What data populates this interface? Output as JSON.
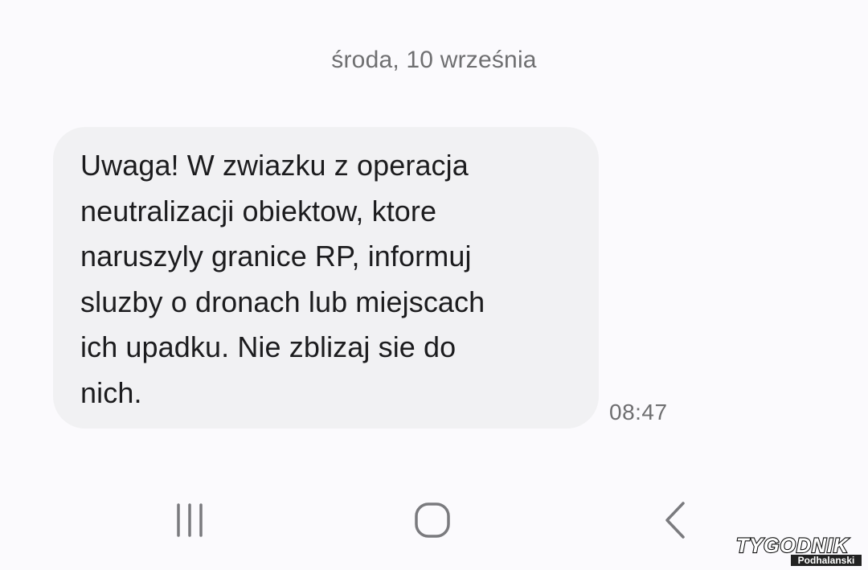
{
  "conversation": {
    "date_separator": "środa, 10 września",
    "message": {
      "lines": [
        "Uwaga! W zwiazku z operacja",
        "neutralizacji obiektow, ktore",
        "naruszyly granice RP, informuj",
        "sluzby o dronach lub miejscach",
        "ich upadku. Nie zblizaj sie do",
        "nich."
      ],
      "time": "08:47",
      "bubble_color": "#f1f1f3"
    }
  },
  "navigation_bar": {
    "icons": [
      "recents-icon",
      "home-icon",
      "back-icon"
    ],
    "icon_color": "#7a7a7e"
  },
  "watermark": {
    "brand_name": "TYGODNIK",
    "subtitle": "Podhalanski"
  }
}
